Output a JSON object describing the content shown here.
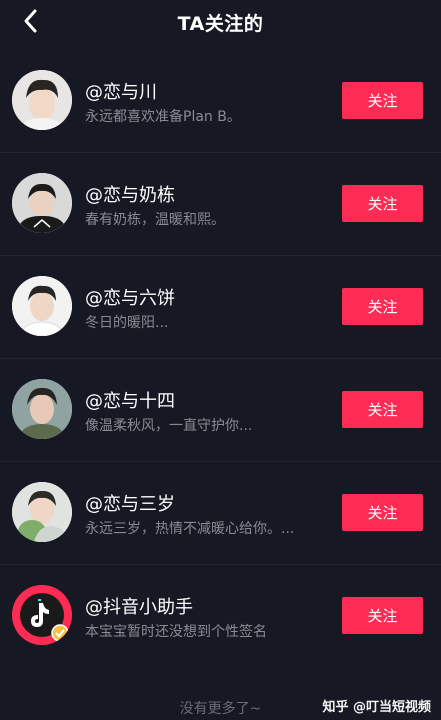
{
  "header": {
    "title": "TA关注的",
    "back_icon": "chevron-left-icon"
  },
  "follow_list": [
    {
      "name": "@恋与川",
      "bio": "永远都喜欢准备Plan B。",
      "button": "关注",
      "avatar": "boy-avatar-1"
    },
    {
      "name": "@恋与奶栋",
      "bio": "春有奶栋，温暖和熙。",
      "button": "关注",
      "avatar": "boy-avatar-2"
    },
    {
      "name": "@恋与六饼",
      "bio": "冬日的暖阳...",
      "button": "关注",
      "avatar": "boy-avatar-3"
    },
    {
      "name": "@恋与十四",
      "bio": "像温柔秋风，一直守护你...",
      "button": "关注",
      "avatar": "boy-avatar-4"
    },
    {
      "name": "@恋与三岁",
      "bio": "永远三岁，热情不减暖心给你。...",
      "button": "关注",
      "avatar": "boy-avatar-5"
    },
    {
      "name": "@抖音小助手",
      "bio": "本宝宝暂时还没想到个性签名",
      "button": "关注",
      "avatar": "douyin-logo-avatar"
    }
  ],
  "footer": {
    "no_more": "没有更多了~",
    "watermark": "知乎 @叮当短视频"
  },
  "colors": {
    "background": "#161823",
    "accent": "#fe2c55",
    "bio_text": "#8a8b91"
  }
}
